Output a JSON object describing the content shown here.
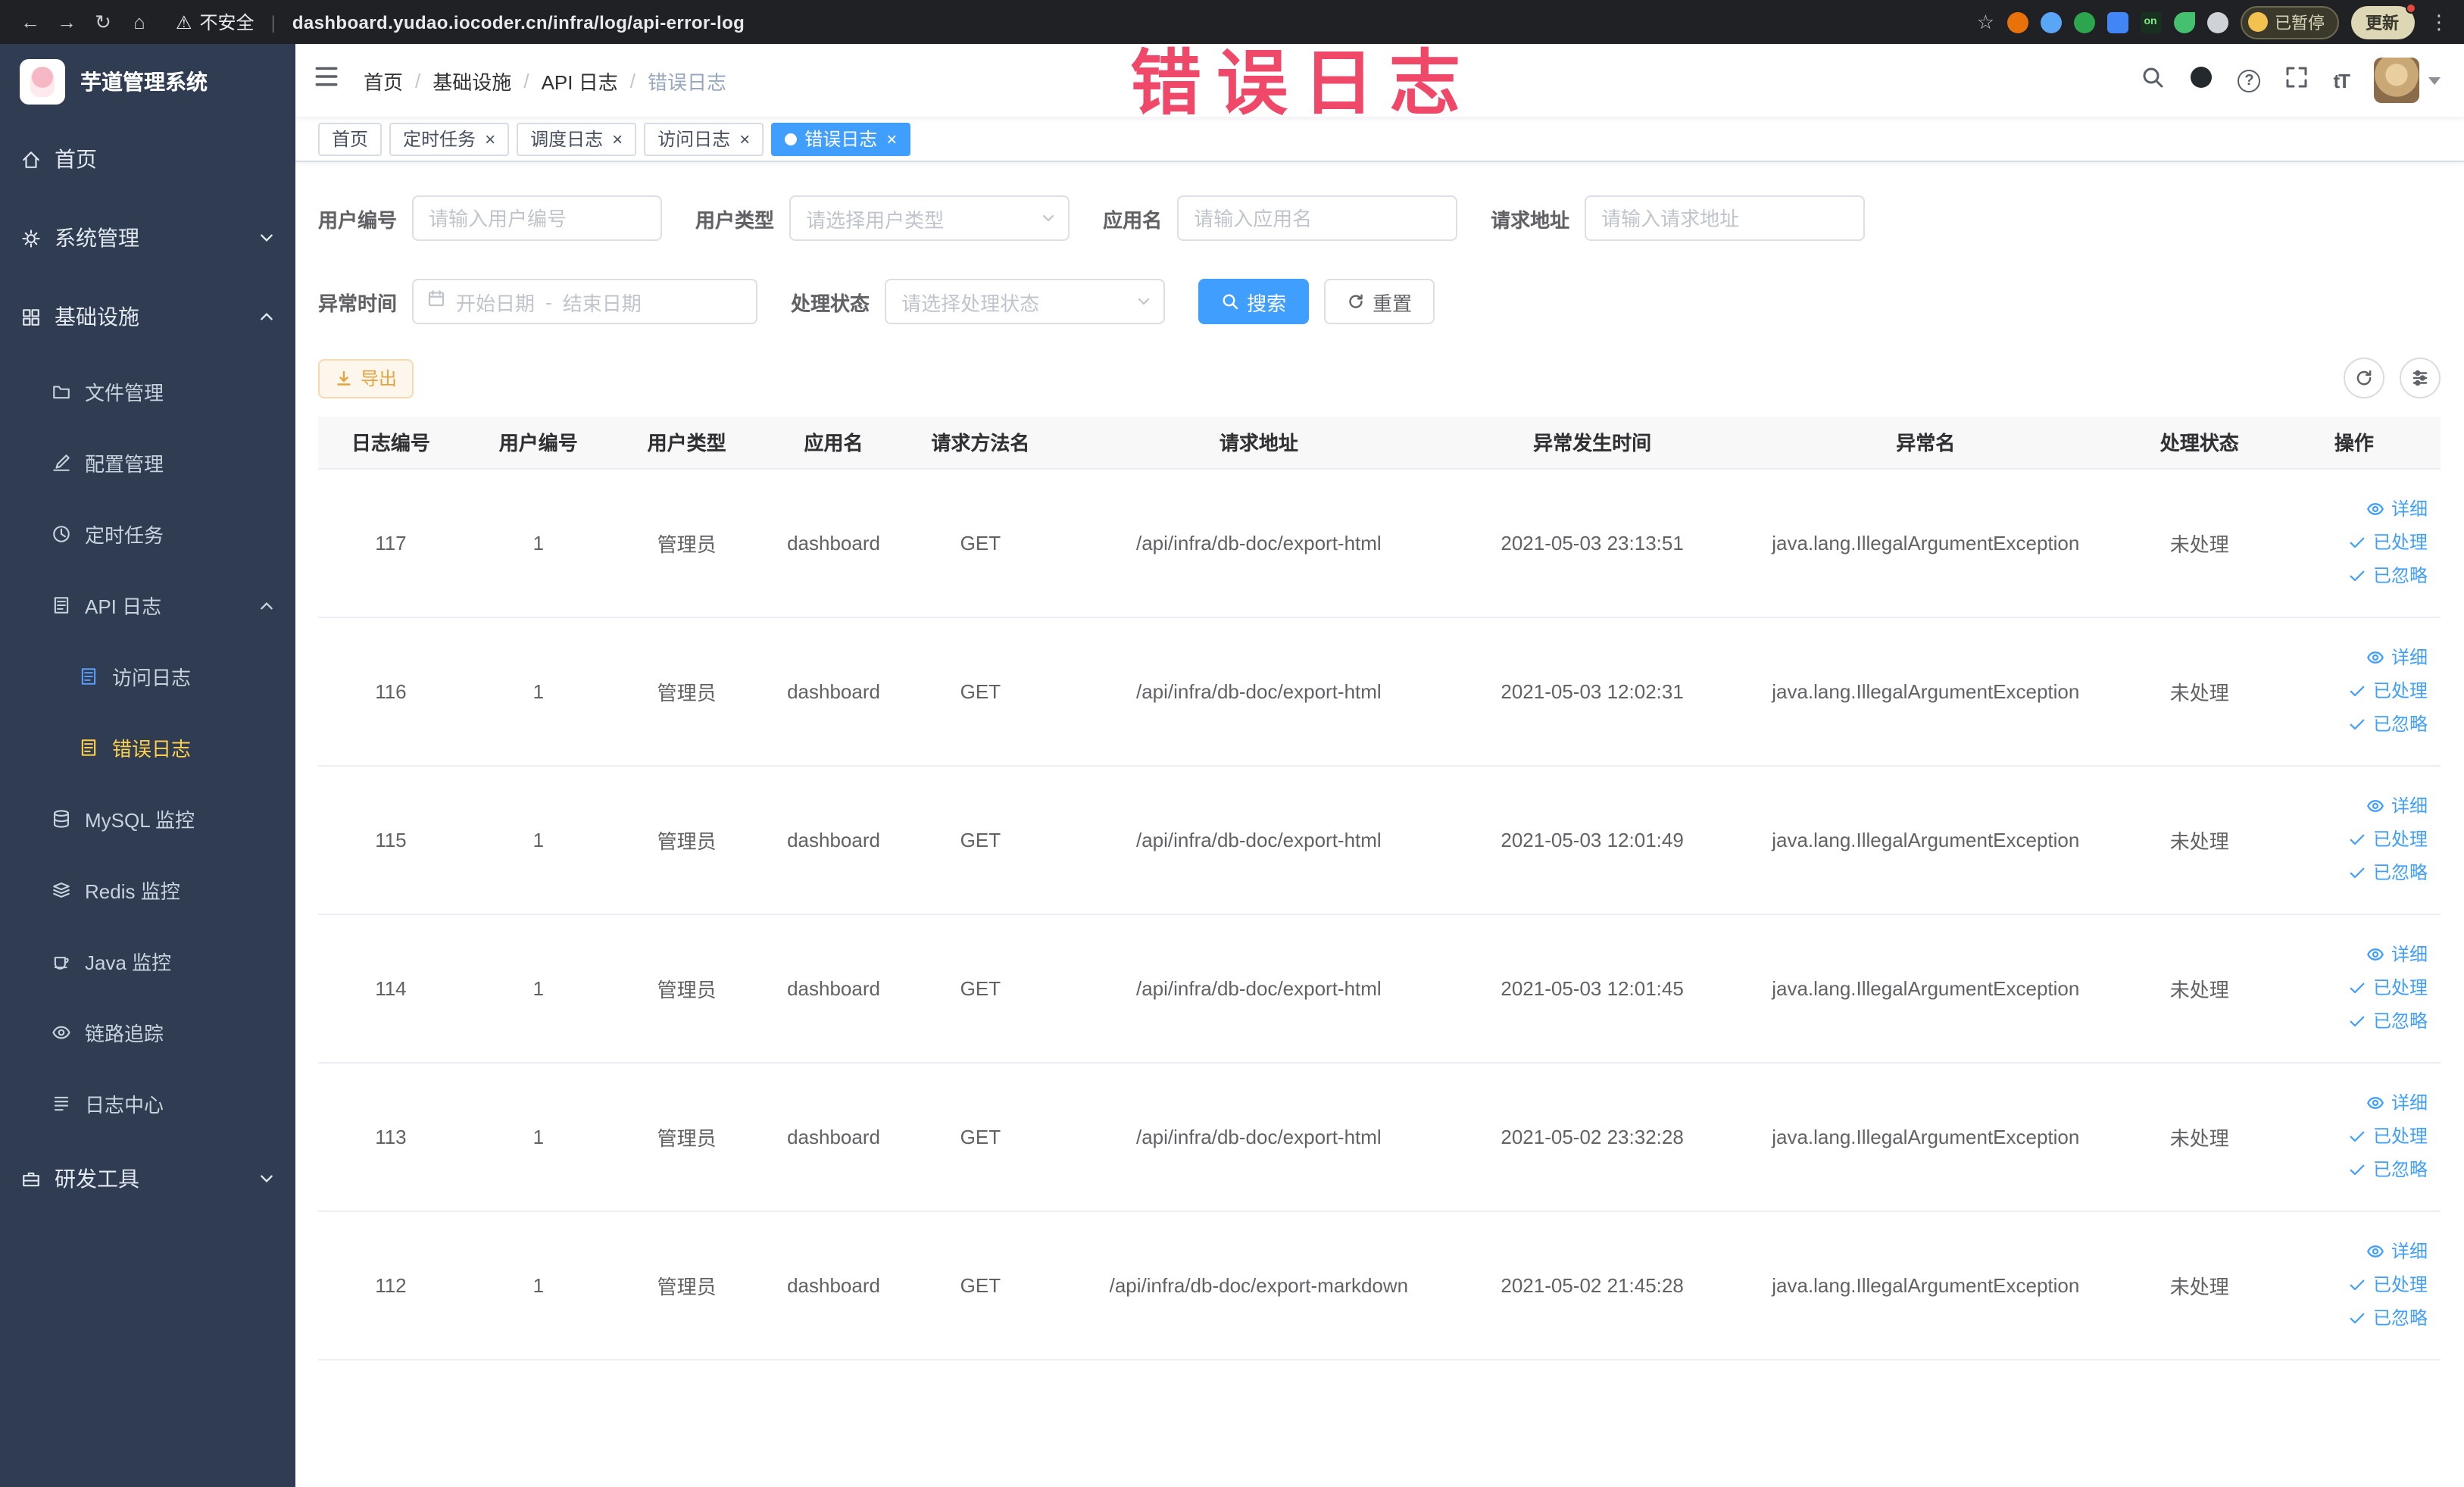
{
  "chrome": {
    "security_label": "不安全",
    "url": "dashboard.yudao.iocoder.cn/infra/log/api-error-log",
    "paused_badge": "已暂停",
    "update_label": "更新",
    "on_badge": "on"
  },
  "glyphs": {
    "back": "←",
    "forward": "→",
    "reload": "↻",
    "home": "⌂",
    "warning": "⚠",
    "omnibox_separator": "|",
    "star": "☆",
    "menu_dots": "⋮",
    "tab_close": "×",
    "breadcrumb_separator": "/",
    "help": "?",
    "font_size": "tT"
  },
  "annotation": {
    "text": "错误日志"
  },
  "sidebar": {
    "title": "芋道管理系统",
    "menu": [
      {
        "label": "首页"
      },
      {
        "label": "系统管理",
        "state": "collapsed"
      },
      {
        "label": "基础设施",
        "state": "expanded"
      },
      {
        "label": "文件管理"
      },
      {
        "label": "配置管理"
      },
      {
        "label": "定时任务"
      },
      {
        "label": "API 日志",
        "state": "expanded"
      },
      {
        "label": "访问日志"
      },
      {
        "label": "错误日志",
        "active": true
      },
      {
        "label": "MySQL 监控"
      },
      {
        "label": "Redis 监控"
      },
      {
        "label": "Java 监控"
      },
      {
        "label": "链路追踪"
      },
      {
        "label": "日志中心"
      },
      {
        "label": "研发工具",
        "state": "collapsed"
      }
    ]
  },
  "topbar": {
    "breadcrumb": [
      "首页",
      "基础设施",
      "API 日志",
      "错误日志"
    ]
  },
  "tabs": [
    {
      "label": "首页",
      "closable": false,
      "active": false
    },
    {
      "label": "定时任务",
      "closable": true,
      "active": false
    },
    {
      "label": "调度日志",
      "closable": true,
      "active": false
    },
    {
      "label": "访问日志",
      "closable": true,
      "active": false
    },
    {
      "label": "错误日志",
      "closable": true,
      "active": true
    }
  ],
  "filters": {
    "user_id": {
      "label": "用户编号",
      "placeholder": "请输入用户编号"
    },
    "user_type": {
      "label": "用户类型",
      "placeholder": "请选择用户类型"
    },
    "app_name": {
      "label": "应用名",
      "placeholder": "请输入应用名"
    },
    "request_url": {
      "label": "请求地址",
      "placeholder": "请输入请求地址"
    },
    "exception_time": {
      "label": "异常时间",
      "start_placeholder": "开始日期",
      "separator": "-",
      "end_placeholder": "结束日期"
    },
    "process_status": {
      "label": "处理状态",
      "placeholder": "请选择处理状态"
    },
    "search_label": "搜索",
    "reset_label": "重置"
  },
  "toolbar": {
    "export_label": "导出"
  },
  "table": {
    "columns": [
      "日志编号",
      "用户编号",
      "用户类型",
      "应用名",
      "请求方法名",
      "请求地址",
      "异常发生时间",
      "异常名",
      "处理状态",
      "操作"
    ],
    "action_labels": [
      "详细",
      "已处理",
      "已忽略"
    ],
    "rows": [
      {
        "id": "117",
        "user_id": "1",
        "user_type": "管理员",
        "app": "dashboard",
        "method": "GET",
        "url": "/api/infra/db-doc/export-html",
        "time": "2021-05-03 23:13:51",
        "exception": "java.lang.IllegalArgumentException",
        "status": "未处理"
      },
      {
        "id": "116",
        "user_id": "1",
        "user_type": "管理员",
        "app": "dashboard",
        "method": "GET",
        "url": "/api/infra/db-doc/export-html",
        "time": "2021-05-03 12:02:31",
        "exception": "java.lang.IllegalArgumentException",
        "status": "未处理"
      },
      {
        "id": "115",
        "user_id": "1",
        "user_type": "管理员",
        "app": "dashboard",
        "method": "GET",
        "url": "/api/infra/db-doc/export-html",
        "time": "2021-05-03 12:01:49",
        "exception": "java.lang.IllegalArgumentException",
        "status": "未处理"
      },
      {
        "id": "114",
        "user_id": "1",
        "user_type": "管理员",
        "app": "dashboard",
        "method": "GET",
        "url": "/api/infra/db-doc/export-html",
        "time": "2021-05-03 12:01:45",
        "exception": "java.lang.IllegalArgumentException",
        "status": "未处理"
      },
      {
        "id": "113",
        "user_id": "1",
        "user_type": "管理员",
        "app": "dashboard",
        "method": "GET",
        "url": "/api/infra/db-doc/export-html",
        "time": "2021-05-02 23:32:28",
        "exception": "java.lang.IllegalArgumentException",
        "status": "未处理"
      },
      {
        "id": "112",
        "user_id": "1",
        "user_type": "管理员",
        "app": "dashboard",
        "method": "GET",
        "url": "/api/infra/db-doc/export-markdown",
        "time": "2021-05-02 21:45:28",
        "exception": "java.lang.IllegalArgumentException",
        "status": "未处理"
      }
    ]
  },
  "colors": {
    "primary": "#409eff",
    "sidebar_bg": "#2f3c52",
    "active_menu": "#ffd04b",
    "warning": "#e6a23c",
    "annotation": "#ee385c"
  }
}
